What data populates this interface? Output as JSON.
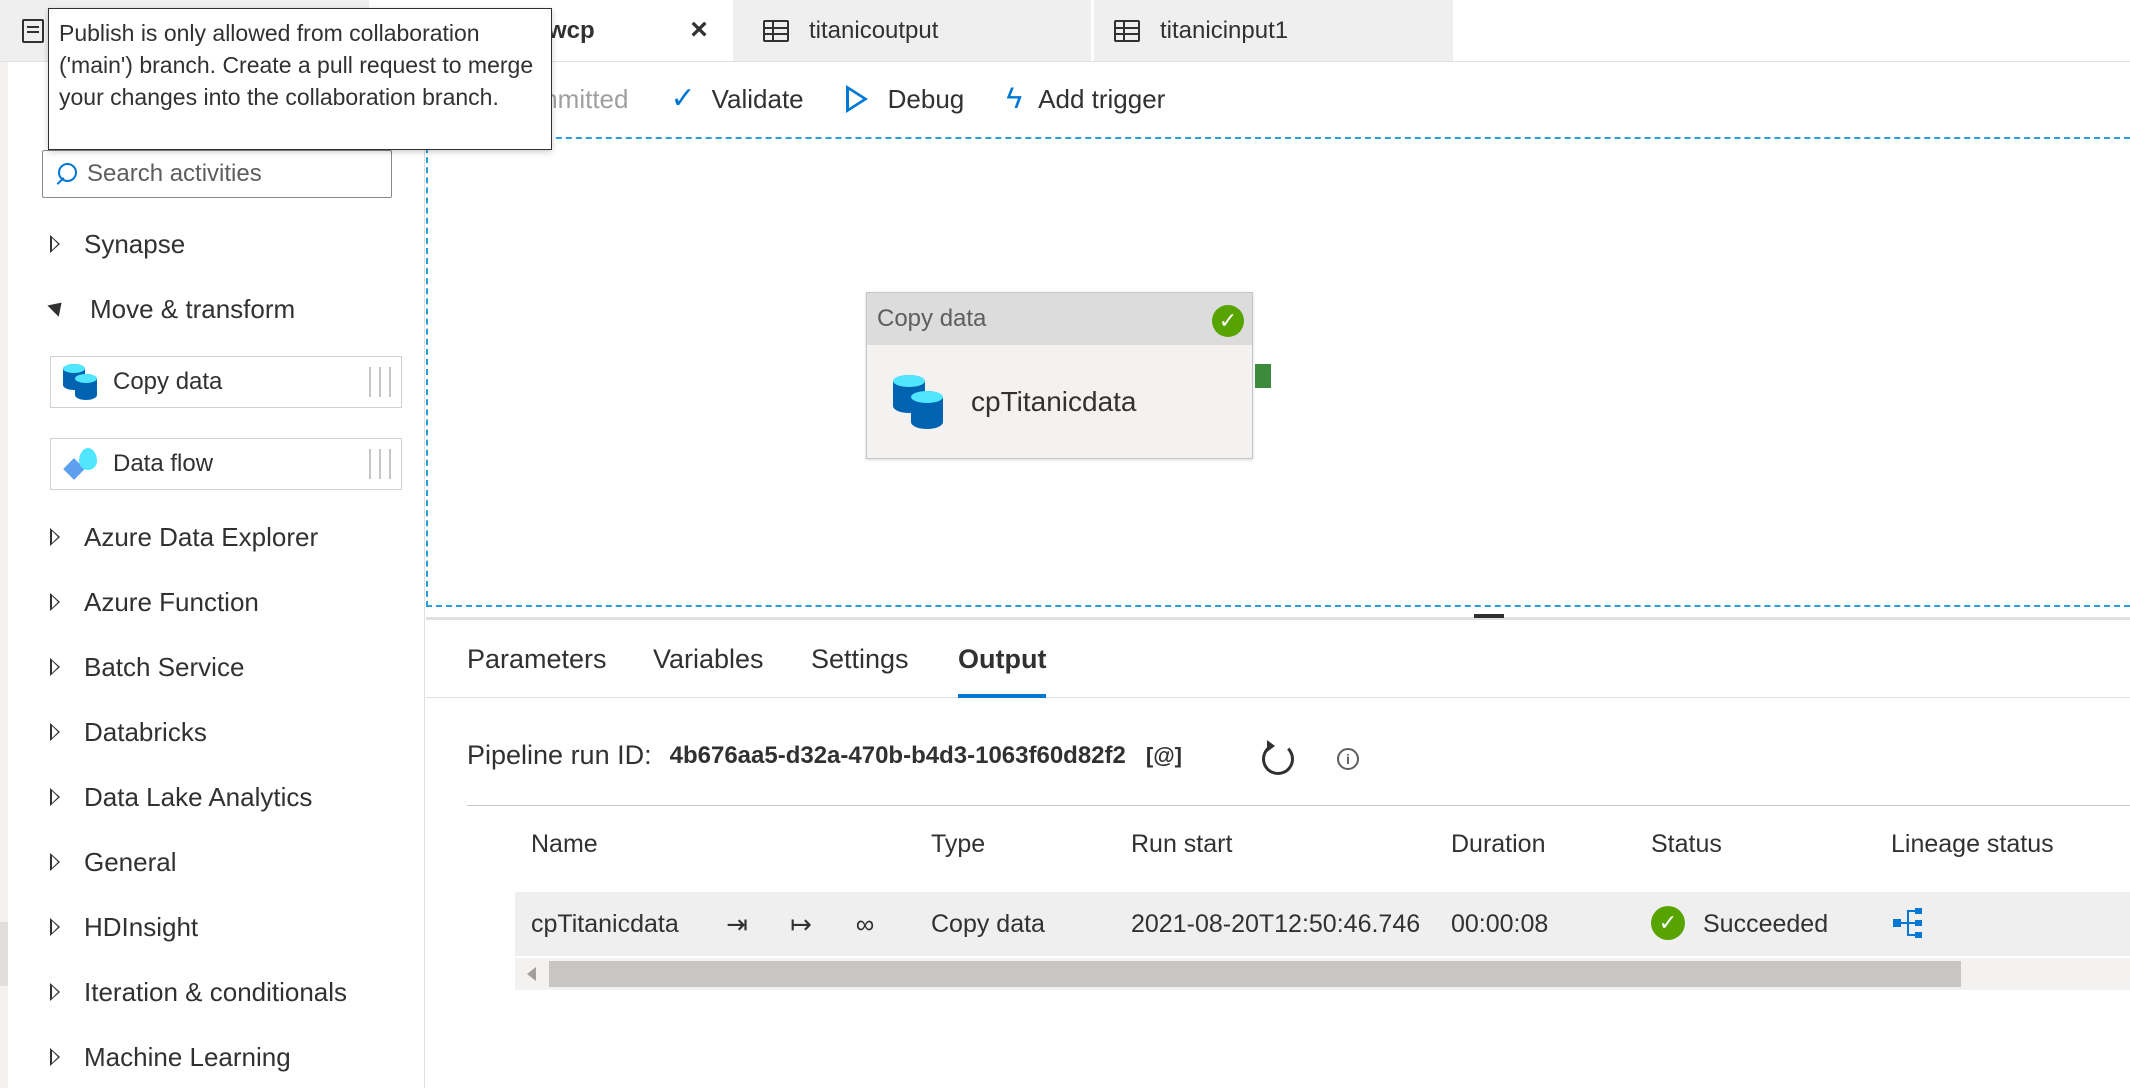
{
  "tabs": [
    {
      "label": "wcp",
      "active": true
    },
    {
      "label": "titanicoutput"
    },
    {
      "label": "titanicinput1"
    }
  ],
  "tooltip": {
    "text": "Publish is only allowed from collaboration ('main') branch. Create a pull request to merge your changes into the collaboration branch."
  },
  "toolbar": {
    "partial_label": "mmitted",
    "validate_label": "Validate",
    "debug_label": "Debug",
    "trigger_label": "Add trigger"
  },
  "sidebar": {
    "search_placeholder": "Search activities",
    "categories": [
      {
        "label": "Synapse",
        "expanded": false
      },
      {
        "label": "Move & transform",
        "expanded": true
      },
      {
        "label": "Azure Data Explorer",
        "expanded": false
      },
      {
        "label": "Azure Function",
        "expanded": false
      },
      {
        "label": "Batch Service",
        "expanded": false
      },
      {
        "label": "Databricks",
        "expanded": false
      },
      {
        "label": "Data Lake Analytics",
        "expanded": false
      },
      {
        "label": "General",
        "expanded": false
      },
      {
        "label": "HDInsight",
        "expanded": false
      },
      {
        "label": "Iteration & conditionals",
        "expanded": false
      },
      {
        "label": "Machine Learning",
        "expanded": false
      }
    ],
    "activities": [
      {
        "label": "Copy data",
        "icon": "copy-data-icon"
      },
      {
        "label": "Data flow",
        "icon": "data-flow-icon"
      }
    ]
  },
  "canvas": {
    "node": {
      "type_label": "Copy data",
      "name": "cpTitanicdata",
      "status": "succeeded"
    }
  },
  "panel": {
    "tabs": [
      "Parameters",
      "Variables",
      "Settings",
      "Output"
    ],
    "active_tab": "Output",
    "run_id_label": "Pipeline run ID:",
    "run_id": "4b676aa5-d32a-470b-b4d3-1063f60d82f2",
    "copy_glyph": "[@]",
    "columns": [
      "Name",
      "Type",
      "Run start",
      "Duration",
      "Status",
      "Lineage status"
    ],
    "rows": [
      {
        "name": "cpTitanicdata",
        "type": "Copy data",
        "run_start": "2021-08-20T12:50:46.746",
        "duration": "00:00:08",
        "status": "Succeeded"
      }
    ]
  },
  "colors": {
    "accent": "#0078d4",
    "success": "#57a300",
    "canvas_border": "#2b9ed9"
  }
}
